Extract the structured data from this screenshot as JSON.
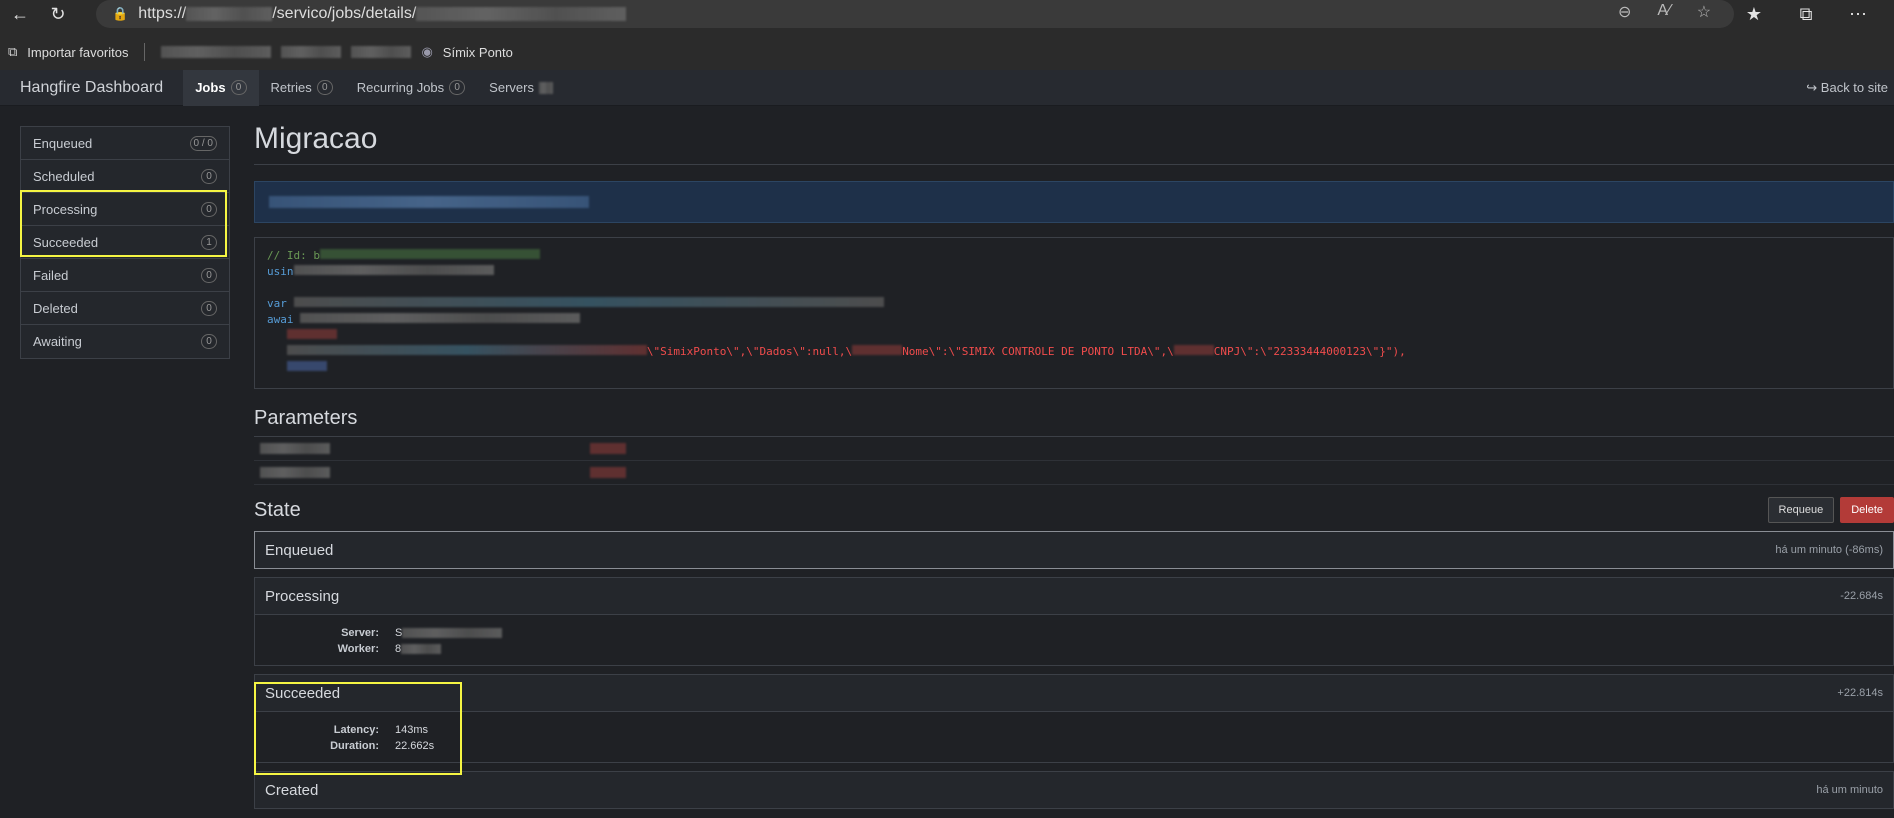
{
  "browser": {
    "url_prefix": "https://",
    "url_path": "/servico/jobs/details/",
    "favorites": {
      "import_label": "Importar favoritos",
      "bookmark_label": "Símix Ponto"
    }
  },
  "nav": {
    "brand": "Hangfire Dashboard",
    "items": [
      {
        "label": "Jobs",
        "count": "0"
      },
      {
        "label": "Retries",
        "count": "0"
      },
      {
        "label": "Recurring Jobs",
        "count": "0"
      },
      {
        "label": "Servers",
        "count": ""
      }
    ],
    "back": "Back to site"
  },
  "sidebar": {
    "items": [
      {
        "label": "Enqueued",
        "count": "0 / 0"
      },
      {
        "label": "Scheduled",
        "count": "0"
      },
      {
        "label": "Processing",
        "count": "0"
      },
      {
        "label": "Succeeded",
        "count": "1"
      },
      {
        "label": "Failed",
        "count": "0"
      },
      {
        "label": "Deleted",
        "count": "0"
      },
      {
        "label": "Awaiting",
        "count": "0"
      }
    ]
  },
  "job": {
    "title": "Migracao",
    "code": {
      "line1": "// Id: b",
      "line2": "usin",
      "line3": "var",
      "line4": "awai",
      "args_tail_1": "\\\"SimixPonto\\\",\\\"Dados\\\":null,\\",
      "args_tail_2": "Nome\\\":\\\"SIMIX CONTROLE DE PONTO LTDA\\\",\\",
      "args_tail_3": "CNPJ\\\":\\\"22333444000123\\\"}\"),"
    },
    "parameters_heading": "Parameters",
    "state_heading": "State",
    "requeue_label": "Requeue",
    "delete_label": "Delete"
  },
  "states": [
    {
      "name": "Enqueued",
      "time": "há um minuto (-86ms)"
    },
    {
      "name": "Processing",
      "time": "-22.684s",
      "details": [
        {
          "key": "Server:",
          "value": "S"
        },
        {
          "key": "Worker:",
          "value": "8"
        }
      ]
    },
    {
      "name": "Succeeded",
      "time": "+22.814s",
      "details": [
        {
          "key": "Latency:",
          "value": "143ms"
        },
        {
          "key": "Duration:",
          "value": "22.662s"
        }
      ]
    },
    {
      "name": "Created",
      "time": "há um minuto"
    }
  ],
  "colors": {
    "highlight": "#f5f543",
    "danger": "#b33b38",
    "note_bg": "#1e3049"
  }
}
